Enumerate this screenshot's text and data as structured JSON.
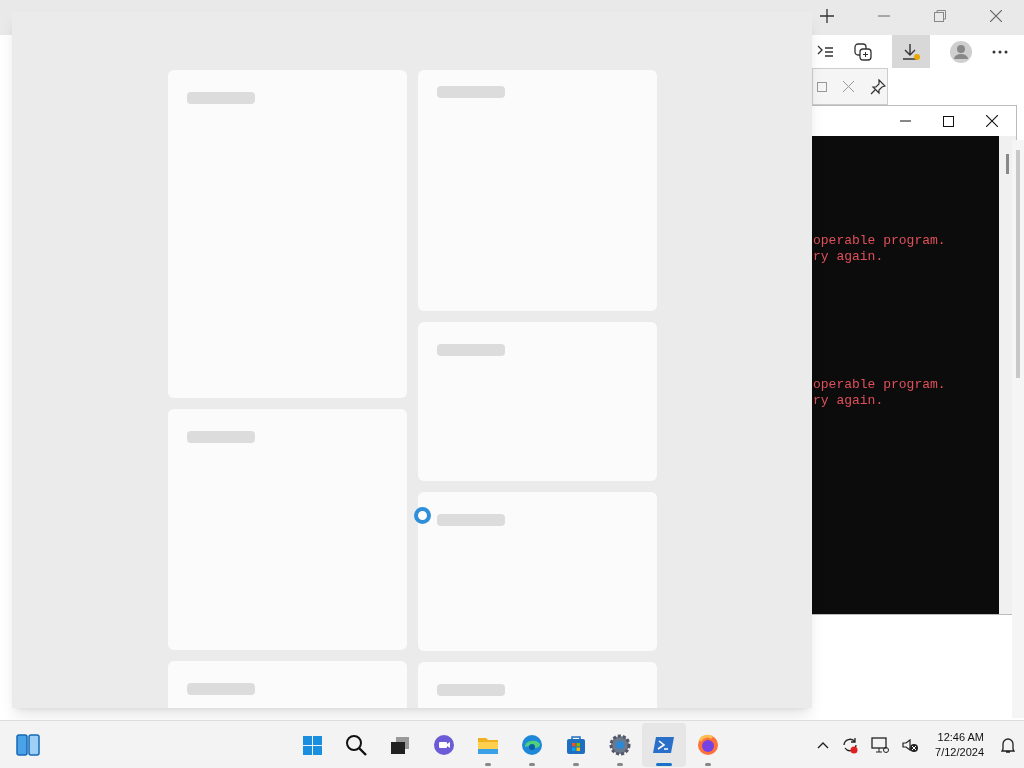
{
  "widgets_panel": {
    "loading": true,
    "columns": [
      [
        {
          "kind": "large"
        },
        {
          "kind": "medium"
        },
        {
          "kind": "cut"
        }
      ],
      [
        {
          "kind": "medium"
        },
        {
          "kind": "small"
        },
        {
          "kind": "small"
        },
        {
          "kind": "cut"
        }
      ]
    ]
  },
  "terminal": {
    "lines": [
      {
        "text": "operable program.",
        "kind": "error"
      },
      {
        "text": "ry again.",
        "kind": "error"
      },
      {
        "kind": "gap"
      },
      {
        "text": "operable program.",
        "kind": "error"
      },
      {
        "text": "ry again.",
        "kind": "error"
      }
    ]
  },
  "taskbar": {
    "apps": [
      {
        "kind": "start",
        "running": false,
        "active": false
      },
      {
        "kind": "search",
        "running": false,
        "active": false
      },
      {
        "kind": "taskview",
        "running": false,
        "active": false
      },
      {
        "kind": "chat",
        "running": false,
        "active": false
      },
      {
        "kind": "explorer",
        "running": true,
        "active": false
      },
      {
        "kind": "edge",
        "running": true,
        "active": false
      },
      {
        "kind": "store",
        "running": true,
        "active": false
      },
      {
        "kind": "settings",
        "running": true,
        "active": false
      },
      {
        "kind": "powershell",
        "running": true,
        "active": true
      },
      {
        "kind": "firefox",
        "running": true,
        "active": false
      }
    ],
    "clock": {
      "time": "12:46 AM",
      "date": "7/12/2024"
    }
  }
}
